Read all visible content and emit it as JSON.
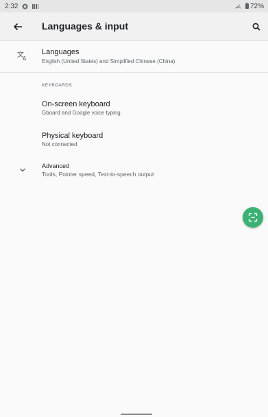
{
  "status_bar": {
    "time": "2:32",
    "battery": "72%"
  },
  "app_bar": {
    "title": "Languages & input"
  },
  "languages": {
    "title": "Languages",
    "subtitle": "English (United States) and Simplified Chinese (China)"
  },
  "keyboards": {
    "header": "KEYBOARDS",
    "items": [
      {
        "title": "On-screen keyboard",
        "subtitle": "Gboard and Google voice typing"
      },
      {
        "title": "Physical keyboard",
        "subtitle": "Not connected"
      }
    ]
  },
  "advanced": {
    "title": "Advanced",
    "subtitle": "Tools, Pointer speed, Text-to-speech output"
  },
  "colors": {
    "fab": "#3bb273",
    "app_bar": "#f1f1f1",
    "background": "#fafafa"
  }
}
